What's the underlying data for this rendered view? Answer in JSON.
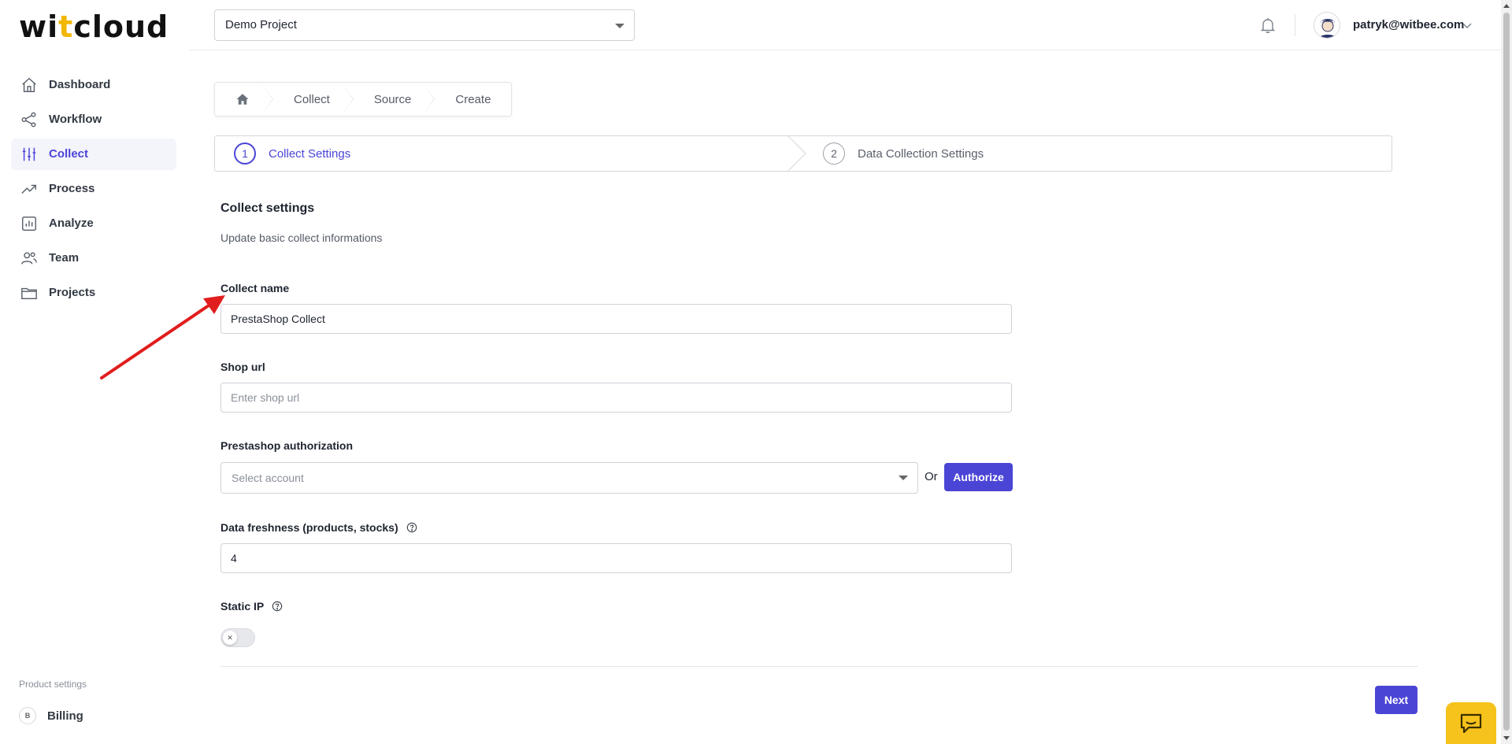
{
  "app": {
    "logo_left": "wi",
    "logo_accent": "t",
    "logo_right": "cloud",
    "accent_color": "#4b45d6",
    "logo_accent_color": "#f2b705"
  },
  "topbar": {
    "project": "Demo Project",
    "notifications_icon": "bell-icon",
    "user_email": "patryk@witbee.com"
  },
  "sidebar": {
    "items": [
      {
        "label": "Dashboard",
        "icon": "home-icon",
        "active": false
      },
      {
        "label": "Workflow",
        "icon": "share-icon",
        "active": false
      },
      {
        "label": "Collect",
        "icon": "sliders-icon",
        "active": true
      },
      {
        "label": "Process",
        "icon": "trending-icon",
        "active": false
      },
      {
        "label": "Analyze",
        "icon": "bar-chart-icon",
        "active": false
      },
      {
        "label": "Team",
        "icon": "users-icon",
        "active": false
      },
      {
        "label": "Projects",
        "icon": "folder-icon",
        "active": false
      }
    ],
    "product_settings_label": "Product settings",
    "billing_badge": "B",
    "billing_label": "Billing"
  },
  "breadcrumb": {
    "home_icon": "home-icon",
    "items": [
      "Collect",
      "Source",
      "Create"
    ]
  },
  "stepper": {
    "steps": [
      {
        "num": "1",
        "label": "Collect Settings",
        "active": true
      },
      {
        "num": "2",
        "label": "Data Collection Settings",
        "active": false
      }
    ]
  },
  "form": {
    "title": "Collect settings",
    "subtitle": "Update basic collect informations",
    "collect_name_label": "Collect name",
    "collect_name_value": "PrestaShop Collect",
    "shop_url_label": "Shop url",
    "shop_url_placeholder": "Enter shop url",
    "auth_label": "Prestashop authorization",
    "account_placeholder": "Select account",
    "or_text": "Or",
    "authorize_label": "Authorize",
    "freshness_label": "Data freshness (products, stocks)",
    "freshness_value": "4",
    "static_ip_label": "Static IP",
    "static_ip_enabled": false,
    "next_label": "Next"
  }
}
